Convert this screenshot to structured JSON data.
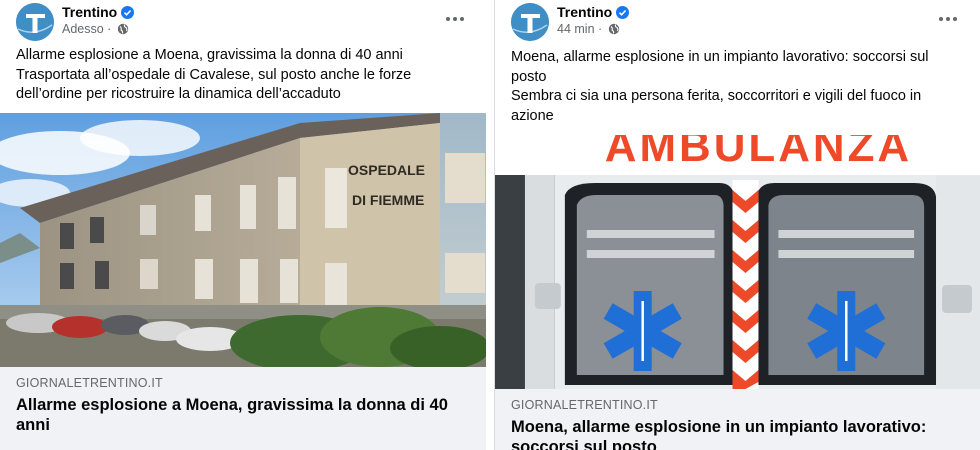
{
  "posts": [
    {
      "page_name": "Trentino",
      "time": "Adesso",
      "text_lines": [
        "Allarme esplosione a Moena, gravissima la donna di 40 anni",
        "Trasportata all’ospedale di Cavalese, sul posto anche le forze",
        "dell’ordine per ricostruire la dinamica dell’accaduto"
      ],
      "image_text": [
        "OSPEDALE",
        "DI FIEMME"
      ],
      "link_domain": "GIORNALETRENTINO.IT",
      "link_title_lines": [
        "Allarme esplosione a Moena, gravissima la donna di 40",
        "anni"
      ]
    },
    {
      "page_name": "Trentino",
      "time": "44 min",
      "text_lines": [
        "Moena, allarme esplosione in un impianto lavorativo: soccorsi sul",
        "posto",
        "Sembra ci sia una persona ferita, soccorritori e vigili del fuoco in",
        "azione"
      ],
      "image_text": [
        "AMBULANZA"
      ],
      "link_domain": "GIORNALETRENTINO.IT",
      "link_title_lines": [
        "Moena, allarme esplosione in un impianto lavorativo:",
        "soccorsi sul posto"
      ]
    }
  ],
  "icons": {
    "avatar": "trentino-logo-icon",
    "verified": "verified-badge-icon",
    "audience": "globe-icon",
    "more": "more-options-icon"
  },
  "colors": {
    "verified": "#1877f2",
    "secondary_text": "#65676b",
    "preview_bg": "#f0f2f5",
    "logo": "#3f8fc6"
  }
}
